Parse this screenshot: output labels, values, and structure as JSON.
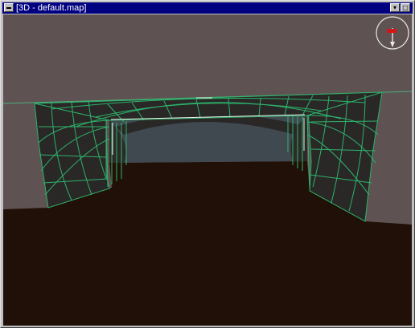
{
  "window": {
    "title": "[3D - default.map]",
    "controls": {
      "system_menu": "window-menu-icon",
      "minimize": "▾",
      "maximize": "□"
    }
  },
  "viewport": {
    "description_colors": {
      "sky": "#5e5252",
      "ground": "#211007",
      "wall": "#2a2727",
      "grid_line": "#2db36a",
      "opening": "#404850"
    },
    "compass_icon": "compass-icon",
    "compass_accent": "#d01818"
  }
}
